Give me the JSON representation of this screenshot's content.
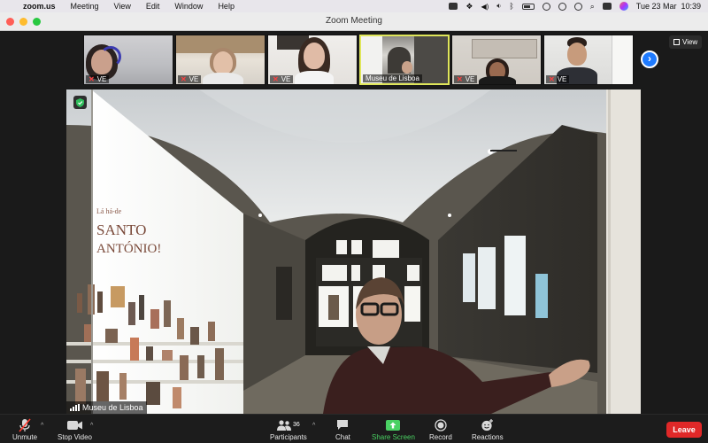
{
  "menubar": {
    "app_name": "zoom.us",
    "items": [
      "Meeting",
      "View",
      "Edit",
      "Window",
      "Help"
    ],
    "datetime": "Tue 23 Mar  10:39"
  },
  "window": {
    "title": "Zoom Meeting"
  },
  "gallery": {
    "participants": [
      {
        "name": "VE",
        "muted": true
      },
      {
        "name": "VE",
        "muted": true
      },
      {
        "name": "VE",
        "muted": true
      },
      {
        "name": "Museu de Lisboa",
        "muted": false,
        "active": true
      },
      {
        "name": "VE",
        "muted": true
      },
      {
        "name": "VE",
        "muted": true
      }
    ],
    "view_label": "View"
  },
  "main_video": {
    "speaker_name": "Museu de Lisboa",
    "wall_text": [
      "Lá há-de",
      "SANTO",
      "ANTÓNIO!"
    ]
  },
  "toolbar": {
    "unmute": "Unmute",
    "stop_video": "Stop Video",
    "participants": "Participants",
    "participant_count": "36",
    "chat": "Chat",
    "share_screen": "Share Screen",
    "record": "Record",
    "reactions": "Reactions",
    "leave": "Leave"
  },
  "colors": {
    "accent_green": "#4ad163",
    "leave_red": "#e02828",
    "active_speaker_border": "#dfe65a",
    "next_button_blue": "#1f7bff"
  }
}
